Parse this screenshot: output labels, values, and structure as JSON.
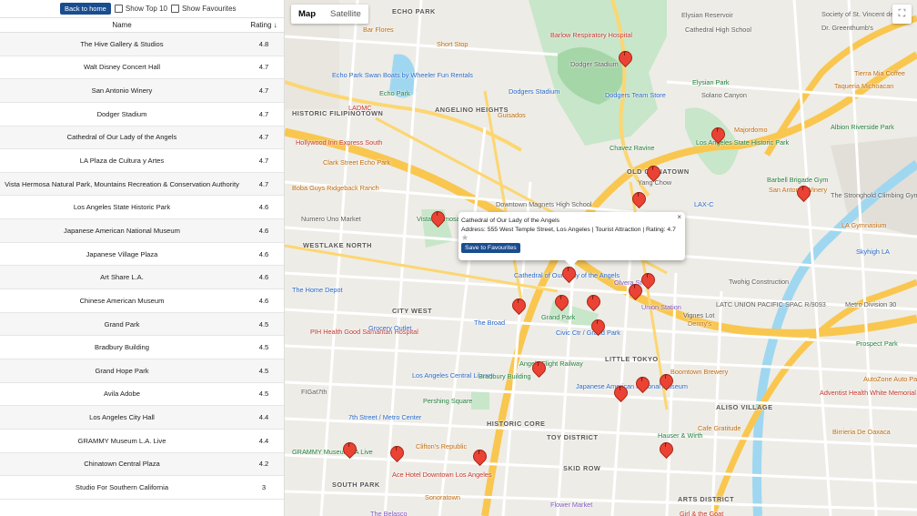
{
  "controls": {
    "back_label": "Back to home",
    "show_top10_label": "Show Top 10",
    "show_favourites_label": "Show Favourites"
  },
  "table": {
    "columns": {
      "name": "Name",
      "rating": "Rating ↓"
    },
    "rows": [
      {
        "name": "The Hive Gallery & Studios",
        "rating": "4.8"
      },
      {
        "name": "Walt Disney Concert Hall",
        "rating": "4.7"
      },
      {
        "name": "San Antonio Winery",
        "rating": "4.7"
      },
      {
        "name": "Dodger Stadium",
        "rating": "4.7"
      },
      {
        "name": "Cathedral of Our Lady of the Angels",
        "rating": "4.7"
      },
      {
        "name": "LA Plaza de Cultura y Artes",
        "rating": "4.7"
      },
      {
        "name": "Vista Hermosa Natural Park, Mountains Recreation & Conservation Authority",
        "rating": "4.7"
      },
      {
        "name": "Los Angeles State Historic Park",
        "rating": "4.6"
      },
      {
        "name": "Japanese American National Museum",
        "rating": "4.6"
      },
      {
        "name": "Japanese Village Plaza",
        "rating": "4.6"
      },
      {
        "name": "Art Share L.A.",
        "rating": "4.6"
      },
      {
        "name": "Chinese American Museum",
        "rating": "4.6"
      },
      {
        "name": "Grand Park",
        "rating": "4.5"
      },
      {
        "name": "Bradbury Building",
        "rating": "4.5"
      },
      {
        "name": "Grand Hope Park",
        "rating": "4.5"
      },
      {
        "name": "Avila Adobe",
        "rating": "4.5"
      },
      {
        "name": "Los Angeles City Hall",
        "rating": "4.4"
      },
      {
        "name": "GRAMMY Museum L.A. Live",
        "rating": "4.4"
      },
      {
        "name": "Chinatown Central Plaza",
        "rating": "4.2"
      },
      {
        "name": "Studio For Southern California",
        "rating": "3"
      }
    ]
  },
  "map": {
    "type_map": "Map",
    "type_satellite": "Satellite",
    "fullscreen_icon": "⛶",
    "info": {
      "title": "Cathedral of Our Lady of the Angels",
      "address": "Address: 555 West Temple Street, Los Angeles | Tourist Attraction | Rating: 4.7",
      "star": "★",
      "button": "Save to Favourites",
      "close": "×"
    },
    "labels": [
      "ECHO PARK",
      "Bar Flores",
      "Short Stop",
      "Barlow Respiratory Hospital",
      "Dodger Stadium",
      "Elysian Reservoir",
      "Cathedral High School",
      "Society of St. Vincent de Paul",
      "Dr. Greenthumb's",
      "Echo Park Swan Boats by Wheeler Fun Rentals",
      "Echo Park",
      "Dodgers Stadium",
      "Dodgers Team Store",
      "Solano Canyon",
      "Tierra Mia Coffee",
      "Taqueria Michoacan",
      "HISTORIC FILIPINOTOWN",
      "LADMC",
      "ANGELINO HEIGHTS",
      "Guisados",
      "Elysian Park",
      "Majordomo",
      "Albion Riverside Park",
      "Hollywood Inn Express South",
      "Chavez Ravine",
      "Los Angeles State Historic Park",
      "Clark Street Echo Park",
      "OLD CHINATOWN",
      "Barbell Brigade Gym",
      "San Antonio Winery",
      "Boba Guys Ridgeback Ranch",
      "The Stronghold Climbing Gym",
      "Numero Uno Market",
      "LA Gymnasium",
      "Vista Hermosa Natural Park Mountains Recreation",
      "WESTLAKE NORTH",
      "Downtown Magnets High School",
      "Yang Chow",
      "LAX-C",
      "Skyhigh LA",
      "The Home Depot",
      "Cathedral of Our Lady of the Angels",
      "Olvera St",
      "Union Station",
      "Vignes Lot",
      "Twohig Construction",
      "CITY WEST",
      "Grand Park",
      "Civic Ctr / Grand Park",
      "LATC UNION PACIFIC SPAC R/9093",
      "Metro Division 30",
      "PIH Health Good Samaritan Hospital",
      "Grocery Outlet",
      "The Broad",
      "Angels Flight Railway",
      "LITTLE TOKYO",
      "Denny's",
      "Prospect Park",
      "Los Angeles Central Library",
      "Bradbury Building",
      "Boomtown Brewery",
      "FIGat7th",
      "Pershing Square",
      "Japanese American National Museum",
      "ALISO VILLAGE",
      "Adventist Health White Memorial",
      "7th Street / Metro Center",
      "HISTORIC CORE",
      "Birrieria De Oaxaca",
      "Clifton's Republic",
      "TOY DISTRICT",
      "Hauser & Wirth",
      "Cafe Gratitude",
      "GRAMMY Museum LA Live",
      "Ace Hotel Downtown Los Angeles",
      "SKID ROW",
      "SOUTH PARK",
      "Sonoratown",
      "Flower Market",
      "ARTS DISTRICT",
      "The Belasco",
      "AutoZone Auto Parts",
      "Girl & the Goat"
    ]
  }
}
